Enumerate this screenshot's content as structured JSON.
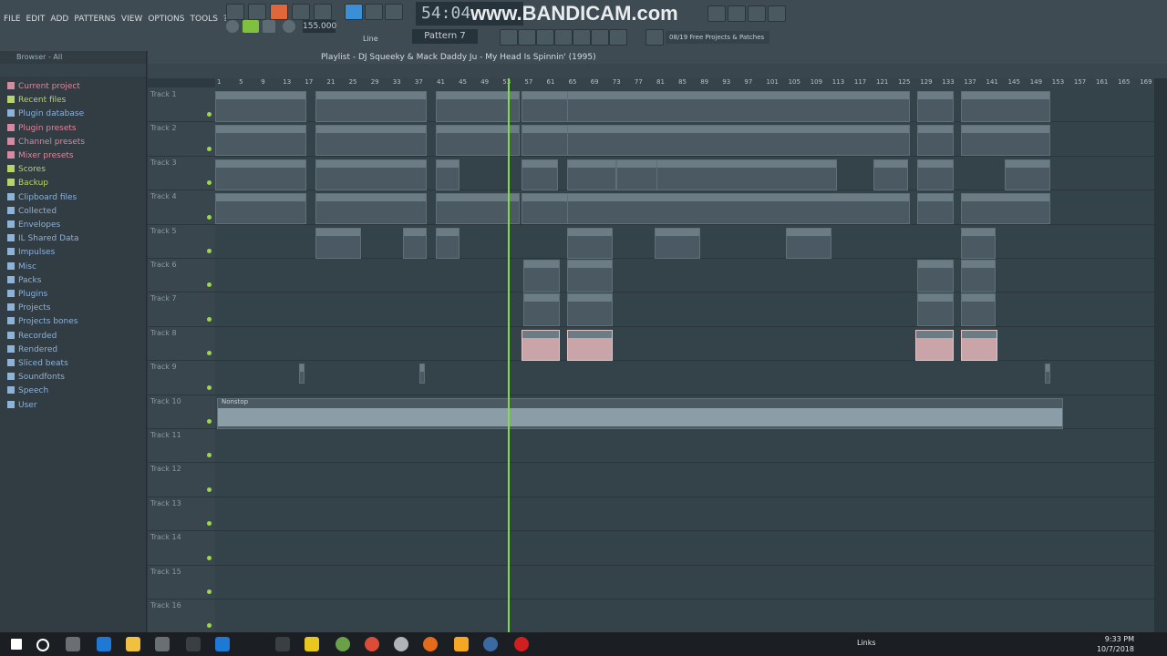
{
  "menu": [
    "FILE",
    "EDIT",
    "ADD",
    "PATTERNS",
    "VIEW",
    "OPTIONS",
    "TOOLS",
    "?"
  ],
  "transport": {
    "clock": "54:04",
    "bpm": "155.000",
    "pattern": "Pattern 7",
    "snap": "Line"
  },
  "watermark": "www.BANDICAM.com",
  "news": "08/19  Free Projects & Patches",
  "browser": {
    "header": "Browser - All",
    "items": [
      {
        "label": "Current project",
        "color": "#d68aa0"
      },
      {
        "label": "Recent files",
        "color": "#b7d36b"
      },
      {
        "label": "Plugin database",
        "color": "#8fb2d8"
      },
      {
        "label": "Plugin presets",
        "color": "#d68aa0"
      },
      {
        "label": "Channel presets",
        "color": "#d68aa0"
      },
      {
        "label": "Mixer presets",
        "color": "#d68aa0"
      },
      {
        "label": "Scores",
        "color": "#b7d36b"
      },
      {
        "label": "Backup",
        "color": "#b7d36b"
      },
      {
        "label": "Clipboard files",
        "color": "#8fb2d8"
      },
      {
        "label": "Collected",
        "color": "#8fb2d8"
      },
      {
        "label": "Envelopes",
        "color": "#8fb2d8"
      },
      {
        "label": "IL Shared Data",
        "color": "#8fb2d8"
      },
      {
        "label": "Impulses",
        "color": "#8fb2d8"
      },
      {
        "label": "Misc",
        "color": "#8fb2d8"
      },
      {
        "label": "Packs",
        "color": "#8fb2d8"
      },
      {
        "label": "Plugins",
        "color": "#8fb2d8"
      },
      {
        "label": "Projects",
        "color": "#8fb2d8"
      },
      {
        "label": "Projects bones",
        "color": "#8fb2d8"
      },
      {
        "label": "Recorded",
        "color": "#8fb2d8"
      },
      {
        "label": "Rendered",
        "color": "#8fb2d8"
      },
      {
        "label": "Sliced beats",
        "color": "#8fb2d8"
      },
      {
        "label": "Soundfonts",
        "color": "#8fb2d8"
      },
      {
        "label": "Speech",
        "color": "#8fb2d8"
      },
      {
        "label": "User",
        "color": "#8fb2d8"
      }
    ]
  },
  "playlist": {
    "title": "Playlist - DJ Squeeky & Mack Daddy Ju - My Head Is Spinnin' (1995)",
    "ruler": [
      "1",
      "5",
      "9",
      "13",
      "17",
      "21",
      "25",
      "29",
      "33",
      "37",
      "41",
      "45",
      "49",
      "53",
      "57",
      "61",
      "65",
      "69",
      "73",
      "77",
      "81",
      "85",
      "89",
      "93",
      "97",
      "101",
      "105",
      "109",
      "113",
      "117",
      "121",
      "125",
      "129",
      "133",
      "137",
      "141",
      "145",
      "149",
      "153",
      "157",
      "161",
      "165",
      "169"
    ],
    "tracks": [
      "Track 1",
      "Track 2",
      "Track 3",
      "Track 4",
      "Track 5",
      "Track 6",
      "Track 7",
      "Track 8",
      "Track 9",
      "Track 10",
      "Track 11",
      "Track 12",
      "Track 13",
      "Track 14",
      "Track 15",
      "Track 16"
    ],
    "audio_clip": "Nonstop"
  },
  "taskbar": {
    "links": "Links",
    "time": "9:33 PM",
    "date": "10/7/2018"
  }
}
